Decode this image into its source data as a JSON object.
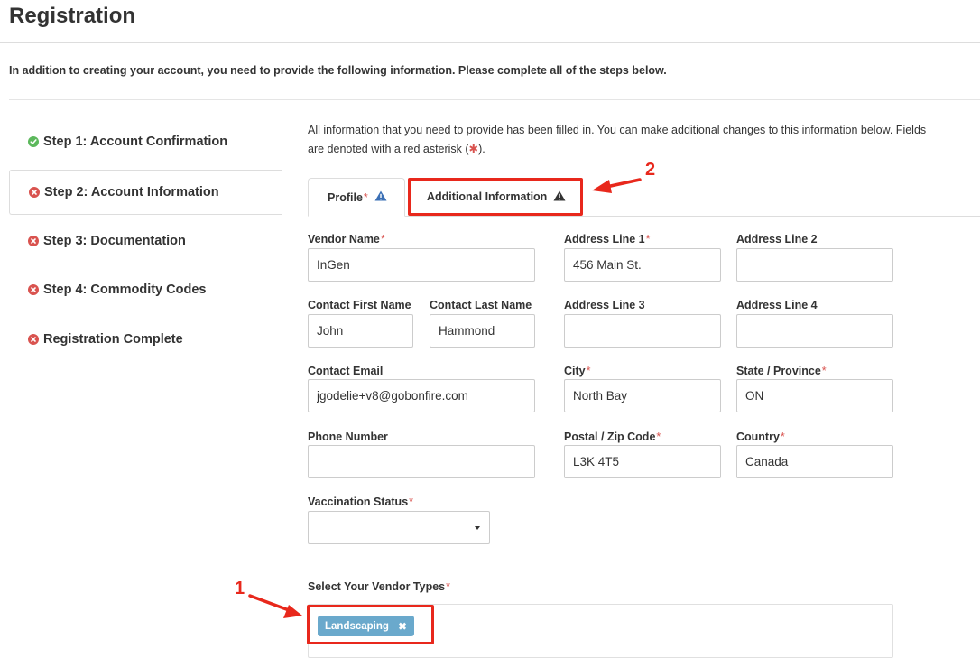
{
  "page": {
    "title": "Registration",
    "intro": "In addition to creating your account, you need to provide the following information. Please complete all of the steps below."
  },
  "steps": [
    {
      "label": "Step 1: Account Confirmation",
      "status": "complete",
      "icon": "check-circle-icon"
    },
    {
      "label": "Step 2: Account Information",
      "status": "incomplete",
      "icon": "x-circle-icon",
      "active": true
    },
    {
      "label": "Step 3: Documentation",
      "status": "incomplete",
      "icon": "x-circle-icon"
    },
    {
      "label": "Step 4: Commodity Codes",
      "status": "incomplete",
      "icon": "x-circle-icon"
    },
    {
      "label": "Registration Complete",
      "status": "incomplete",
      "icon": "x-circle-icon"
    }
  ],
  "info": {
    "line1": "All information that you need to provide has been filled in. You can make additional changes to this information below. Fields",
    "line2_pre": "are denoted with a red asterisk (",
    "line2_mark": "✱",
    "line2_post": ")."
  },
  "tabs": [
    {
      "label": "Profile",
      "required": "*",
      "icon": "warning-triangle-icon",
      "active": true
    },
    {
      "label": "Additional Information",
      "required": "",
      "icon": "warning-triangle-icon",
      "active": false
    }
  ],
  "form": {
    "vendor_name": {
      "label": "Vendor Name",
      "required": "*",
      "value": "InGen"
    },
    "contact_first_name": {
      "label": "Contact First Name",
      "value": "John"
    },
    "contact_last_name": {
      "label": "Contact Last Name",
      "value": "Hammond"
    },
    "contact_email": {
      "label": "Contact Email",
      "value": "jgodelie+v8@gobonfire.com"
    },
    "phone_number": {
      "label": "Phone Number",
      "value": ""
    },
    "vaccination_status": {
      "label": "Vaccination Status",
      "required": "*",
      "value": ""
    },
    "address_line_1": {
      "label": "Address Line 1",
      "required": "*",
      "value": "456 Main St."
    },
    "address_line_2": {
      "label": "Address Line 2",
      "value": ""
    },
    "address_line_3": {
      "label": "Address Line 3",
      "value": ""
    },
    "address_line_4": {
      "label": "Address Line 4",
      "value": ""
    },
    "city": {
      "label": "City",
      "required": "*",
      "value": "North Bay"
    },
    "state_province": {
      "label": "State / Province",
      "required": "*",
      "value": "ON"
    },
    "postal_code": {
      "label": "Postal / Zip Code",
      "required": "*",
      "value": "L3K 4T5"
    },
    "country": {
      "label": "Country",
      "required": "*",
      "value": "Canada"
    },
    "vendor_types": {
      "label": "Select Your Vendor Types",
      "required": "*",
      "tags": [
        "Landscaping"
      ],
      "remove_glyph": "✖"
    }
  },
  "annotations": {
    "one": "1",
    "two": "2",
    "color": "#e8281c"
  },
  "colors": {
    "required": "#d9534f",
    "success": "#5cb85c",
    "error": "#d9534f",
    "tag": "#6aa9cc",
    "warning_blue": "#3a6fb5"
  }
}
